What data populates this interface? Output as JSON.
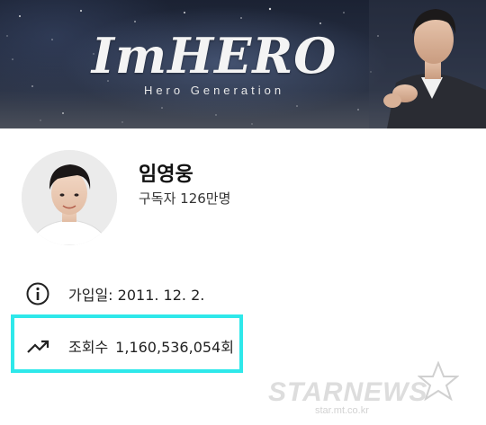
{
  "banner": {
    "title": "ImHERO",
    "subtitle": "Hero Generation"
  },
  "profile": {
    "channel_name": "임영웅",
    "subscribers": "구독자 126만명"
  },
  "about": {
    "joined_label": "가입일:",
    "joined_value": "2011. 12. 2.",
    "views_label": "조회수",
    "views_value": "1,160,536,054회"
  },
  "icons": {
    "info": "info-circle-icon",
    "views": "trending-up-icon"
  },
  "colors": {
    "highlight": "#2ee8ea",
    "banner_dark": "#1b2233"
  },
  "watermark": {
    "brand": "STARNEWS",
    "url": "star.mt.co.kr"
  }
}
